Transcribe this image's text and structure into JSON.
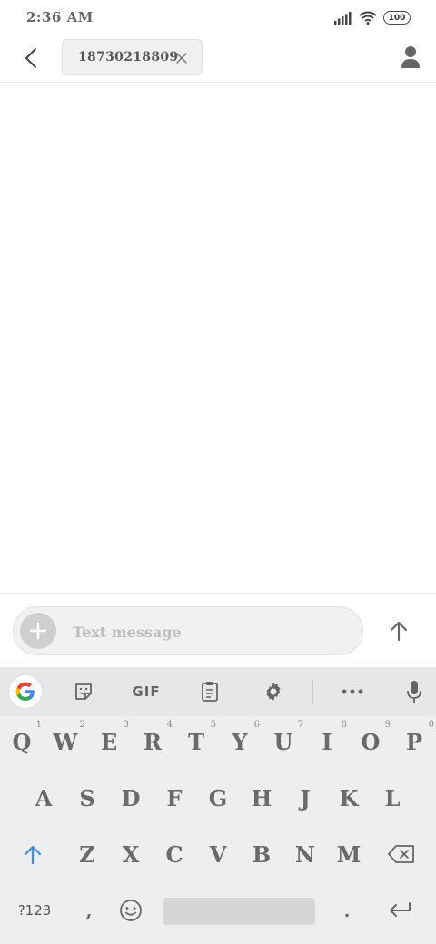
{
  "status": {
    "time": "2:36 AM",
    "battery": "100"
  },
  "header": {
    "recipient": "18730218809"
  },
  "compose": {
    "placeholder": "Text message"
  },
  "keyboard": {
    "toolbar": {
      "gif": "GIF"
    },
    "row1": [
      {
        "key": "Q",
        "hint": "1"
      },
      {
        "key": "W",
        "hint": "2"
      },
      {
        "key": "E",
        "hint": "3"
      },
      {
        "key": "R",
        "hint": "4"
      },
      {
        "key": "T",
        "hint": "5"
      },
      {
        "key": "Y",
        "hint": "6"
      },
      {
        "key": "U",
        "hint": "7"
      },
      {
        "key": "I",
        "hint": "8"
      },
      {
        "key": "O",
        "hint": "9"
      },
      {
        "key": "P",
        "hint": "0"
      }
    ],
    "row2": [
      "A",
      "S",
      "D",
      "F",
      "G",
      "H",
      "J",
      "K",
      "L"
    ],
    "row3": [
      "Z",
      "X",
      "C",
      "V",
      "B",
      "N",
      "M"
    ],
    "row4": {
      "symbols": "?123",
      "comma": ",",
      "period": "."
    }
  }
}
